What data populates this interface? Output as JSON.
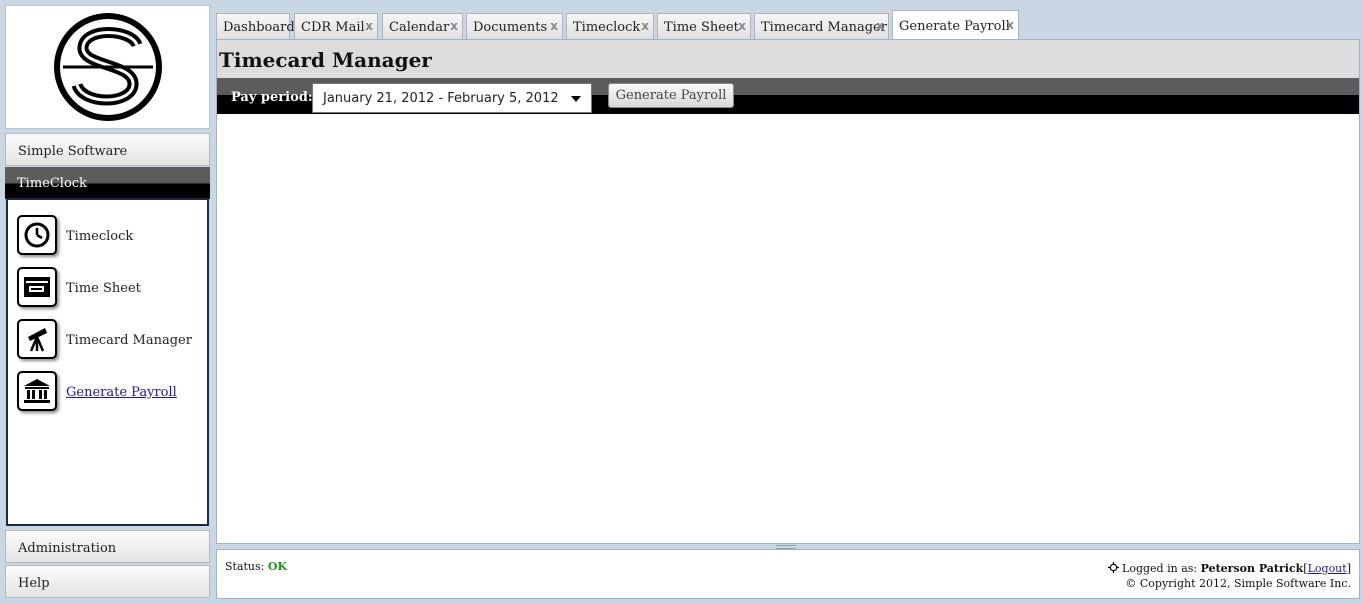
{
  "sidebar": {
    "brand": "Simple Software",
    "active_section": "TimeClock",
    "items": [
      {
        "label": "Timeclock",
        "icon": "clock-icon"
      },
      {
        "label": "Time Sheet",
        "icon": "time-sheet-icon"
      },
      {
        "label": "Timecard Manager",
        "icon": "telescope-icon"
      },
      {
        "label": "Generate Payroll",
        "icon": "bank-icon"
      }
    ],
    "bottom_sections": [
      "Administration",
      "Help"
    ]
  },
  "tabs": [
    {
      "label": "Dashboard",
      "closable": false
    },
    {
      "label": "CDR Mail",
      "closable": true
    },
    {
      "label": "Calendar",
      "closable": true
    },
    {
      "label": "Documents",
      "closable": true
    },
    {
      "label": "Timeclock",
      "closable": true
    },
    {
      "label": "Time Sheet",
      "closable": true
    },
    {
      "label": "Timecard Manager",
      "closable": true
    },
    {
      "label": "Generate Payroll",
      "closable": true,
      "active": true
    }
  ],
  "tab_close_glyph": "x",
  "main": {
    "title": "Timecard Manager",
    "pay_period_label": "Pay period:",
    "pay_period_value": "January 21, 2012 - February 5, 2012",
    "generate_button": "Generate Payroll"
  },
  "footer": {
    "status_label": "Status:",
    "status_value": "OK",
    "logged_in_label": "Logged in as:",
    "user_name": "Peterson Patrick",
    "logout_open": "[",
    "logout_label": "Logout",
    "logout_close": "]",
    "copyright": "© Copyright 2012, Simple Software Inc."
  },
  "colors": {
    "accent_dark": "#000000",
    "status_ok": "#1a9a1a",
    "link": "#1a1aa6",
    "page_background": "#c9d6e4"
  }
}
